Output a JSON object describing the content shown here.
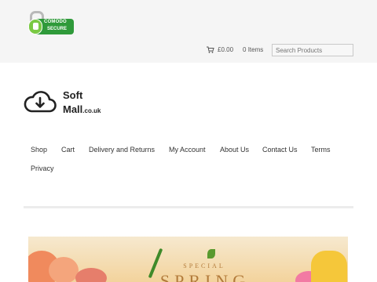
{
  "badge": {
    "line1": "COMODO",
    "line2": "SECURE"
  },
  "cart": {
    "total": "£0.00",
    "items": "0 Items"
  },
  "search": {
    "placeholder": "Search Products"
  },
  "logo": {
    "line1": "Soft",
    "line2": "Mall",
    "suffix": ".co.uk"
  },
  "nav": {
    "items": [
      "Shop",
      "Cart",
      "Delivery and Returns",
      "My Account",
      "About Us",
      "Contact Us",
      "Terms",
      "Privacy"
    ]
  },
  "banner": {
    "line1": "SPECIAL",
    "line2": "SPRING"
  }
}
